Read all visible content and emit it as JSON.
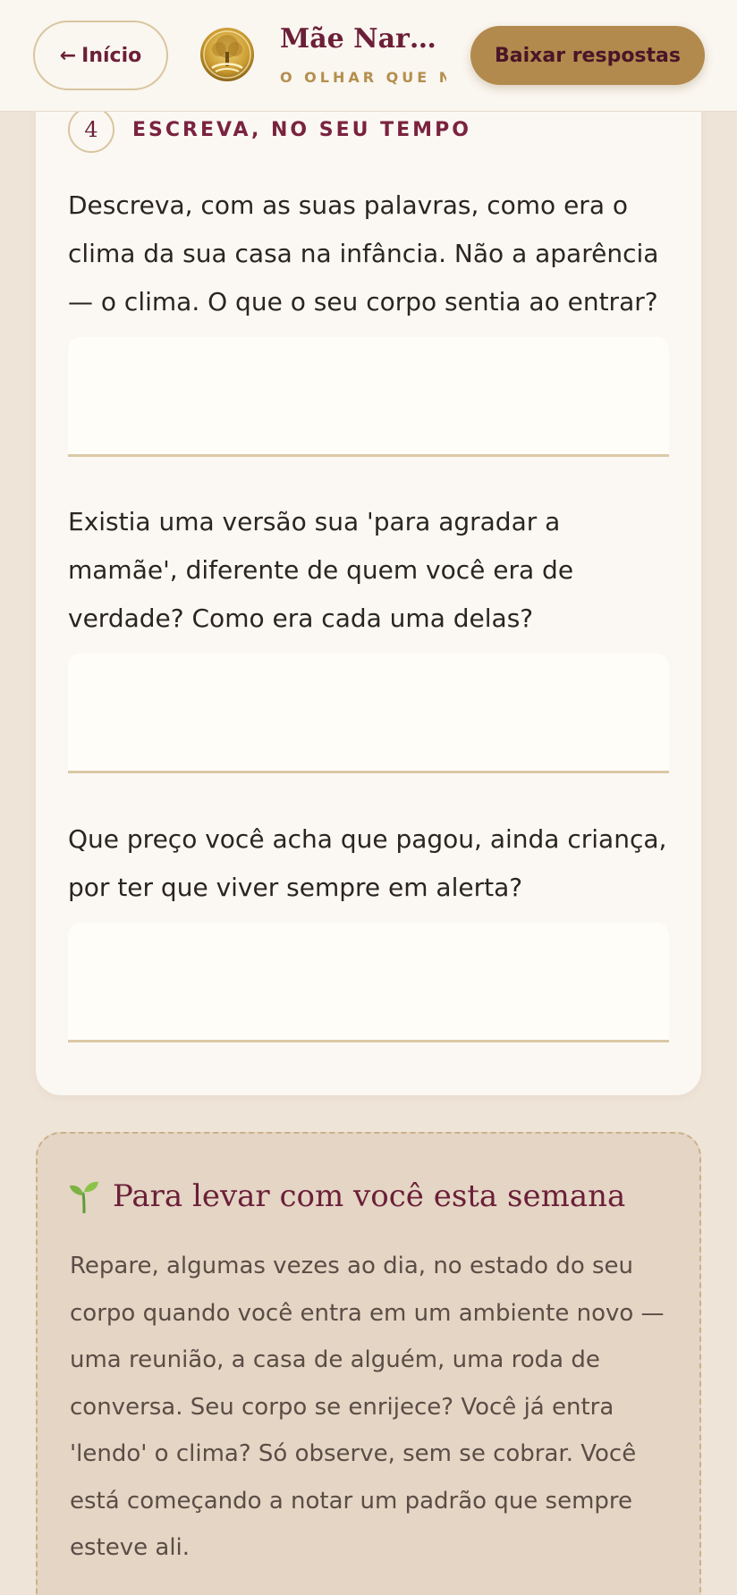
{
  "header": {
    "home_arrow": "←",
    "home_label": "Início",
    "logo_icon": "golden-tree-icon",
    "title": "Mãe Narci...",
    "subtitle": "O OLHAR QUE N",
    "download_label": "Baixar respostas"
  },
  "section": {
    "step_number": "4",
    "step_label": "ESCREVA, NO SEU TEMPO",
    "questions": [
      {
        "text": "Descreva, com as suas palavras, como era o clima da sua casa na infância. Não a aparência — o clima. O que o seu corpo sentia ao entrar?",
        "answer": ""
      },
      {
        "text": "Existia uma versão sua 'para agradar a mamãe', diferente de quem você era de verdade? Como era cada uma delas?",
        "answer": ""
      },
      {
        "text": "Que preço você acha que pagou, ainda criança, por ter que viver sempre em alerta?",
        "answer": ""
      }
    ]
  },
  "takeaway": {
    "icon": "sprout-icon",
    "title": "Para levar com você esta semana",
    "body": "Repare, algumas vezes ao dia, no estado do seu corpo quando você entra em um ambiente novo — uma reunião, a casa de alguém, uma roda de conversa. Seu corpo se enrijece? Você já entra 'lendo' o clima? Só observe, sem se cobrar. Você está começando a notar um padrão que sempre esteve ali."
  },
  "colors": {
    "accent": "#6b1f38",
    "gold": "#b28a4d",
    "background": "#efe4d8"
  }
}
